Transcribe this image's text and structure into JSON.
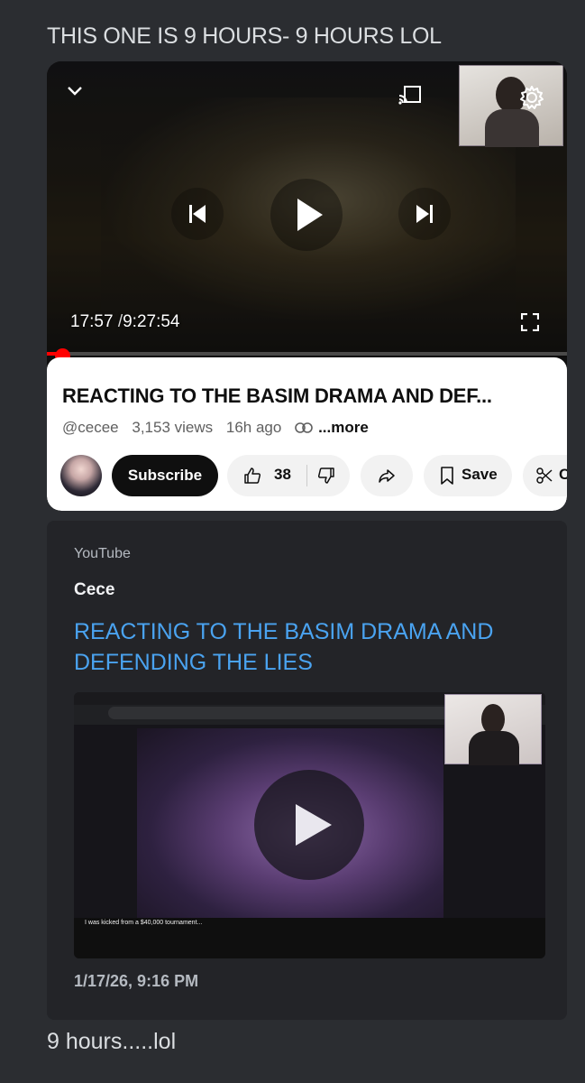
{
  "message_top": "THIS ONE IS 9 HOURS- 9 HOURS LOL",
  "youtube_screenshot": {
    "time_current": "17:57",
    "time_separator": "/",
    "time_total": "9:27:54",
    "progress_fraction": 0.032,
    "title": "REACTING TO THE BASIM DRAMA AND DEF...",
    "channel": "@cecee",
    "views": "3,153 views",
    "age": "16h ago",
    "more": "...more",
    "subscribe_label": "Subscribe",
    "likes": "38",
    "save_label": "Save",
    "clip_label": "C",
    "icons": [
      "chevron-down-icon",
      "cast-icon",
      "gear-icon",
      "previous-icon",
      "play-icon",
      "next-icon",
      "fullscreen-icon",
      "link-icon",
      "thumbs-up-icon",
      "thumbs-down-icon",
      "share-icon",
      "bookmark-icon",
      "scissors-icon"
    ]
  },
  "embed": {
    "provider": "YouTube",
    "author": "Cece",
    "title": "REACTING TO THE BASIM DRAMA AND DEFENDING THE LIES",
    "thumbnail_caption": "I was kicked from a $40,000 tournament...",
    "date": "1/17/26, 9:16 PM",
    "accent_color": "#4aa3f0"
  },
  "message_bottom": "9 hours.....lol"
}
